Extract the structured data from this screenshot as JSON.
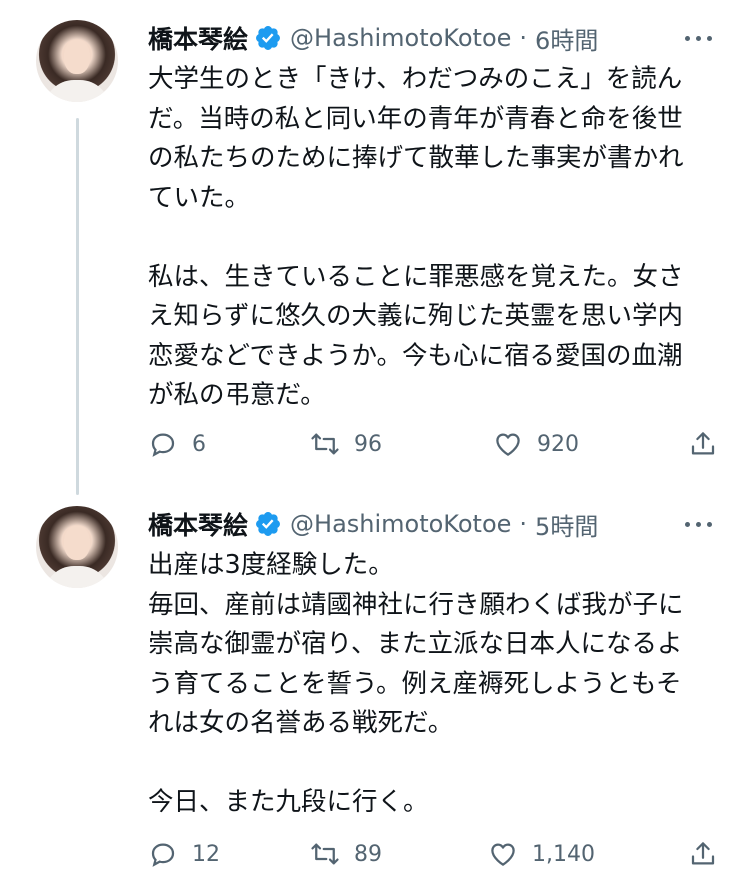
{
  "tweets": [
    {
      "name": "橋本琴絵",
      "handle": "@HashimotoKotoe",
      "sep": "·",
      "time": "6時間",
      "lines": [
        "大学生のとき「きけ、わだつみのこえ」を読ん",
        "だ。当時の私と同い年の青年が青春と命を後世",
        "の私たちのために捧げて散華した事実が書かれ",
        "ていた。",
        "",
        "私は、生きていることに罪悪感を覚えた。女さ",
        "え知らずに悠久の大義に殉じた英霊を思い学内",
        "恋愛などできようか。今も心に宿る愛国の血潮",
        "が私の弔意だ。"
      ],
      "replies": "6",
      "retweets": "96",
      "likes": "920"
    },
    {
      "name": "橋本琴絵",
      "handle": "@HashimotoKotoe",
      "sep": "·",
      "time": "5時間",
      "lines": [
        "出産は3度経験した。",
        "毎回、産前は靖國神社に行き願わくば我が子に",
        "崇高な御霊が宿り、また立派な日本人になるよ",
        "う育てることを誓う。例え産褥死しようともそ",
        "れは女の名誉ある戦死だ。",
        "",
        "今日、また九段に行く。"
      ],
      "replies": "12",
      "retweets": "89",
      "likes": "1,140"
    }
  ],
  "colors": {
    "verified": "#1d9bf0",
    "muted": "#536471",
    "text": "#0f1419",
    "thread": "#cfd9de"
  },
  "icons": [
    "verified-badge-icon",
    "more-icon",
    "reply-icon",
    "retweet-icon",
    "like-icon",
    "share-icon"
  ]
}
